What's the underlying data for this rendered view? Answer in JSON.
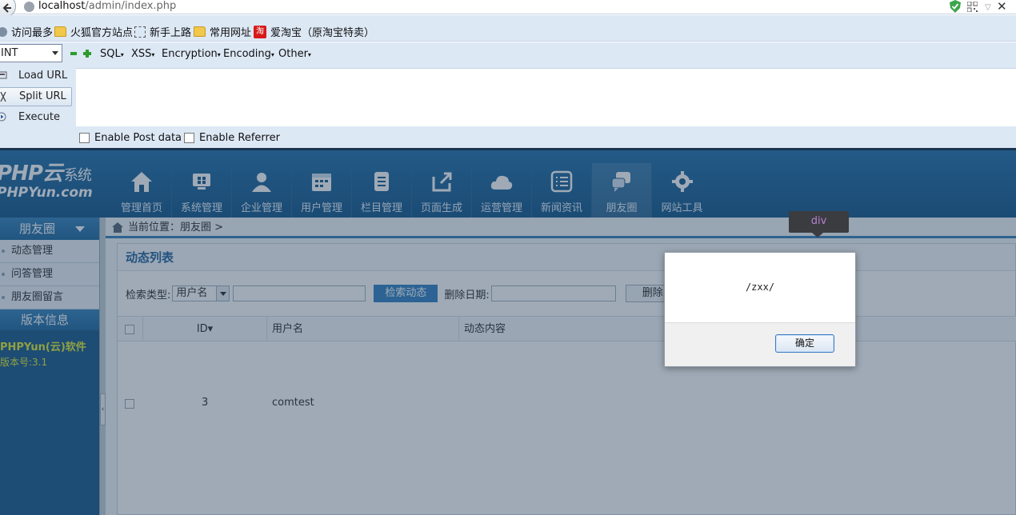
{
  "browser": {
    "url_host": "localhost",
    "url_path": "/admin/index.php"
  },
  "bookmarks": [
    {
      "label": "访问最多",
      "icon": "gear-icon"
    },
    {
      "label": "火狐官方站点",
      "icon": "folder-icon"
    },
    {
      "label": "新手上路",
      "icon": "dashed-box-icon"
    },
    {
      "label": "常用网址",
      "icon": "folder-icon"
    },
    {
      "label": "爱淘宝（原淘宝特卖）",
      "icon": "taobao-icon"
    }
  ],
  "hackbar": {
    "select_value": "INT",
    "menus": [
      "SQL",
      "XSS",
      "Encryption",
      "Encoding",
      "Other"
    ],
    "menu_arrow": "▾",
    "buttons": [
      "Load URL",
      "Split URL",
      "Execute"
    ],
    "checkboxes": [
      "Enable Post data",
      "Enable Referrer"
    ]
  },
  "logo": {
    "line1": "PHP云",
    "line1_suffix": "系统",
    "line2": "PHPYun.com"
  },
  "nav": [
    "管理首页",
    "系统管理",
    "企业管理",
    "用户管理",
    "栏目管理",
    "页面生成",
    "运营管理",
    "新闻资讯",
    "朋友圈",
    "网站工具"
  ],
  "sidebar": {
    "section_title": "朋友圈",
    "items": [
      "动态管理",
      "问答管理",
      "朋友圈留言"
    ],
    "version_title": "版本信息",
    "version_name": "PHPYun(云)软件",
    "version_number": "版本号:3.1"
  },
  "splitter_arrow": "‹",
  "breadcrumb": "当前位置：朋友圈 >",
  "panel_title": "动态列表",
  "filter": {
    "type_label": "检索类型:",
    "type_value": "用户名",
    "search_button": "检索动态",
    "date_label": "删除日期:",
    "delete_button": "删除"
  },
  "table": {
    "headers": [
      "ID▾",
      "用户名",
      "动态内容"
    ],
    "rows": [
      {
        "id": "3",
        "username": "comtest"
      }
    ]
  },
  "tooltip": "div",
  "dialog": {
    "message": "/zxx/",
    "ok_label": "确定"
  }
}
